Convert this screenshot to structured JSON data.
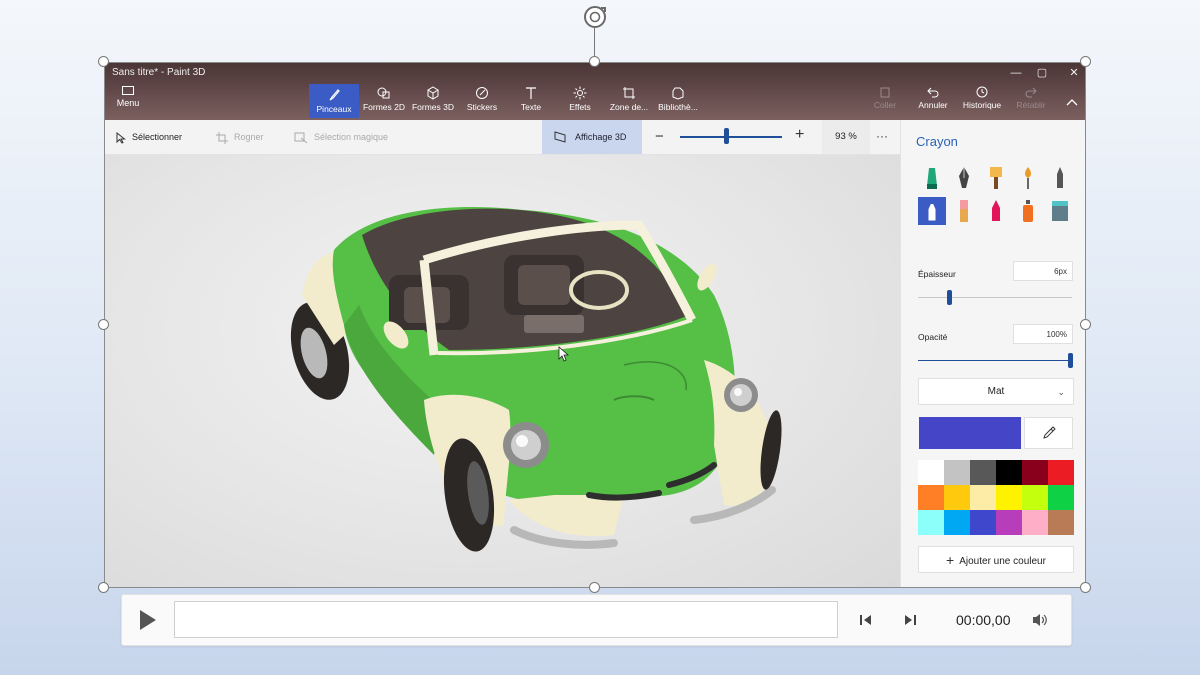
{
  "window": {
    "title": "Sans titre* - Paint 3D",
    "controls": [
      "—",
      "▢",
      "✕"
    ]
  },
  "menu": {
    "label": "Menu"
  },
  "toolbar": {
    "tools": [
      "Pinceaux",
      "Formes 2D",
      "Formes 3D",
      "Stickers",
      "Texte",
      "Effets",
      "Zone de...",
      "Bibliothè..."
    ],
    "active_tool": "Pinceaux",
    "right_tools": [
      "Coller",
      "Annuler",
      "Historique",
      "Rétablir"
    ]
  },
  "subtoolbar": {
    "select": "Sélectionner",
    "crop": "Rogner",
    "magic_select": "Sélection magique",
    "view3d": "Affichage 3D",
    "zoom_value": "93 %",
    "zoom_fraction": 0.45,
    "more": "···"
  },
  "panel": {
    "title": "Crayon",
    "brush_icons": [
      "marker-icon",
      "calligraphy-pen-icon",
      "oil-brush-icon",
      "watercolor-icon",
      "pixel-pen-icon",
      "pencil-icon",
      "eraser-icon",
      "crayon-icon",
      "spray-can-icon",
      "fill-bucket-icon"
    ],
    "active_brush": "pencil-icon",
    "thickness_label": "Épaisseur",
    "thickness_value": "6px",
    "thickness_fraction": 0.2,
    "opacity_label": "Opacité",
    "opacity_value": "100%",
    "opacity_fraction": 1.0,
    "finish_value": "Mat",
    "current_color": "#4545c8",
    "palette": [
      "#ffffff",
      "#c3c3c3",
      "#585858",
      "#000000",
      "#88001b",
      "#ec1c24",
      "#ff7f27",
      "#ffc90e",
      "#fdeca6",
      "#fff200",
      "#c4ff0e",
      "#0ed145",
      "#8cfffb",
      "#00a8f3",
      "#3f48cc",
      "#b83dba",
      "#ffaec8",
      "#b97a56"
    ],
    "add_color": "Ajouter une couleur"
  },
  "media": {
    "time": "00:00,00"
  }
}
